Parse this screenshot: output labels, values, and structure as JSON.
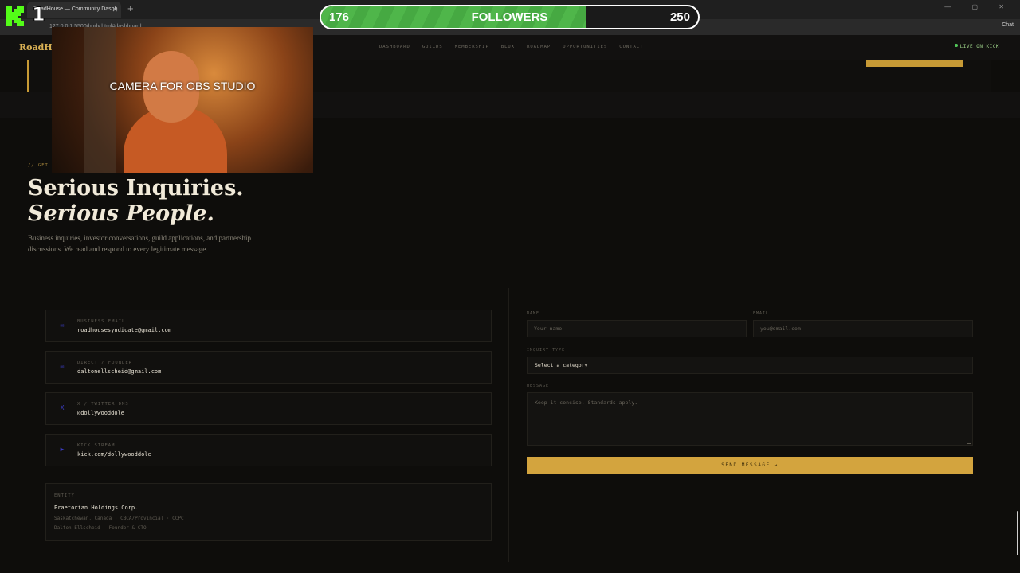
{
  "browser": {
    "tab_title": "RoadHouse — Community Dashb",
    "tab_close": "✕",
    "new_tab": "+",
    "url": "127.0.0.1:5500/body.html#dashboard",
    "window_controls": "— ▢ ✕",
    "chat_label": "Chat"
  },
  "site": {
    "brand": "RoadHo",
    "nav": [
      "DASHBOARD",
      "GUILDS",
      "MEMBERSHIP",
      "BLUX",
      "ROADMAP",
      "OPPORTUNITIES",
      "CONTACT"
    ],
    "live_label": "LIVE ON KICK"
  },
  "section": {
    "eyebrow": "// GET I",
    "heading_line1": "Serious Inquiries.",
    "heading_line2": "Serious People.",
    "lead": "Business inquiries, investor conversations, guild applications, and partnership discussions. We read and respond to every legitimate message."
  },
  "contacts": [
    {
      "label": "BUSINESS EMAIL",
      "value": "roadhousesyndicate@gmail.com",
      "icon": "✉"
    },
    {
      "label": "DIRECT / FOUNDER",
      "value": "daltonellscheid@gmail.com",
      "icon": "✉"
    },
    {
      "label": "X / TWITTER DMS",
      "value": "@dollywooddole",
      "icon": "X"
    },
    {
      "label": "KICK STREAM",
      "value": "kick.com/dollywooddole",
      "icon": "▶"
    }
  ],
  "entity": {
    "label": "ENTITY",
    "name": "Praetorian Holdings Corp.",
    "line1": "Saskatchewan, Canada · CBCA/Provincial · CCPC",
    "line2": "Dalton Ellscheid — Founder & CTO"
  },
  "form": {
    "name_label": "NAME",
    "name_placeholder": "Your name",
    "email_label": "EMAIL",
    "email_placeholder": "you@email.com",
    "type_label": "INQUIRY TYPE",
    "type_value": "Select a category",
    "message_label": "MESSAGE",
    "message_placeholder": "Keep it concise. Standards apply.",
    "send_label": "SEND MESSAGE →"
  },
  "overlay": {
    "kick_number": "1",
    "camera_text": "CAMERA FOR OBS STUDIO",
    "followers_current": "176",
    "followers_label": "FOLLOWERS",
    "followers_goal": "250",
    "followers_progress": 0.704,
    "bar_color": "#4fb64a"
  }
}
